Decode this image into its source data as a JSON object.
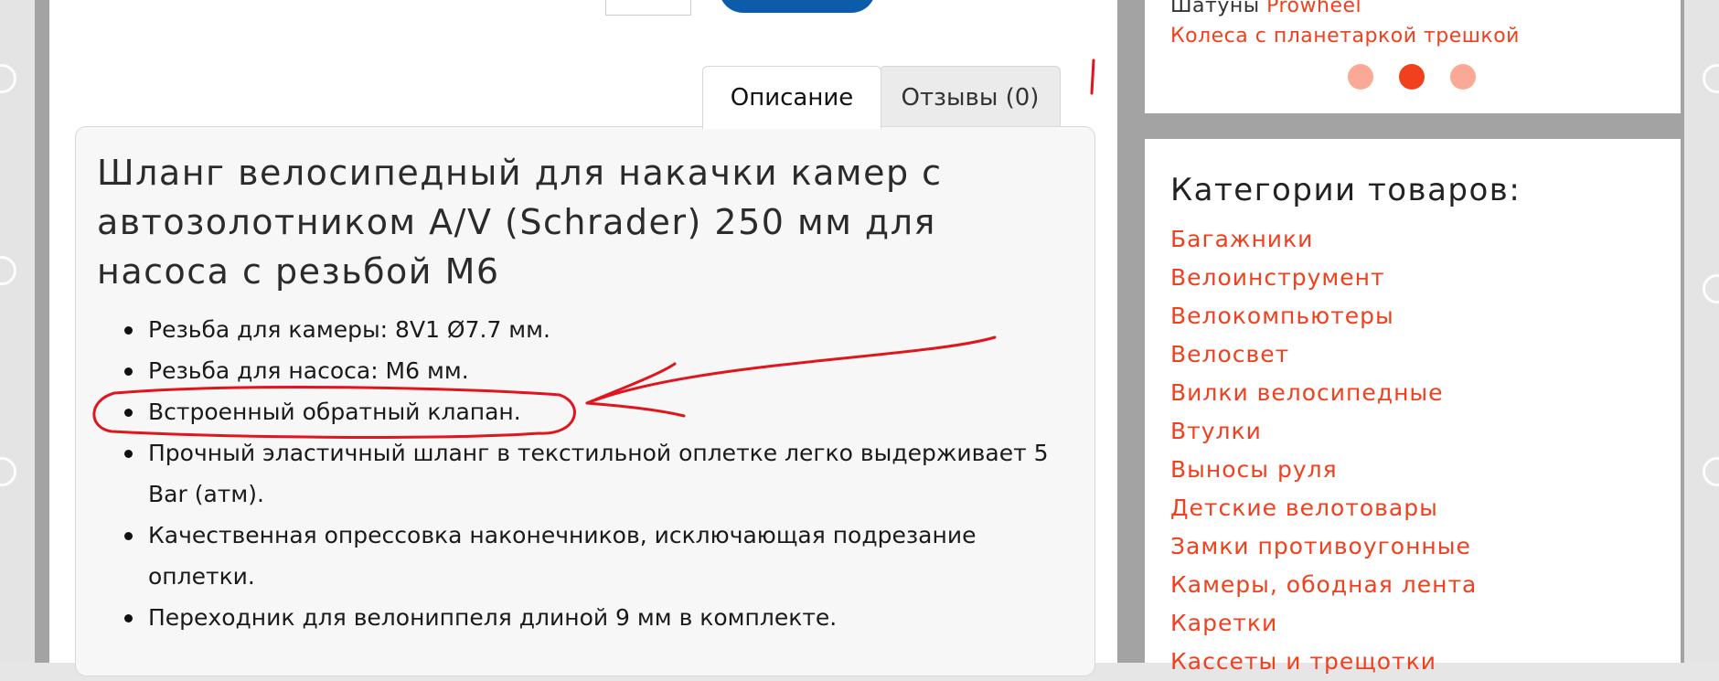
{
  "colors": {
    "accent": "#f0401e",
    "accent_light": "#f9a996",
    "buy_button": "#0c5cab",
    "annotation": "#e0151d"
  },
  "tabs": [
    {
      "label": "Описание",
      "active": true
    },
    {
      "label": "Отзывы (0)",
      "active": false
    }
  ],
  "product": {
    "title": "Шланг велосипедный для накачки камер с автозолотником A/V (Schrader) 250 мм для насоса с резьбой M6",
    "features": [
      "Резьба для камеры: 8V1 Ø7.7 мм.",
      "Резьба для насоса: M6 мм.",
      "Встроенный обратный клапан.",
      "Прочный эластичный шланг в текстильной оплетке легко выдерживает 5 Bar (атм).",
      "Качественная опрессовка наконечников, исключающая подрезание оплетки.",
      "Переходник для велониппеля длиной 9 мм в комплекте."
    ]
  },
  "sidebar_top": {
    "item1_prefix": "Шатуны",
    "item1_link": "Prowheel",
    "item2_link": "Колеса с планетаркой трешкой",
    "slider_dots": 3,
    "active_dot": 2
  },
  "categories": {
    "title": "Категории товаров:",
    "items": [
      "Багажники",
      "Велоинструмент",
      "Велокомпьютеры",
      "Велосвет",
      "Вилки велосипедные",
      "Втулки",
      "Выносы руля",
      "Детские велотовары",
      "Замки противоугонные",
      "Камеры, ободная лента",
      "Каретки",
      "Кассеты и трещотки"
    ]
  }
}
